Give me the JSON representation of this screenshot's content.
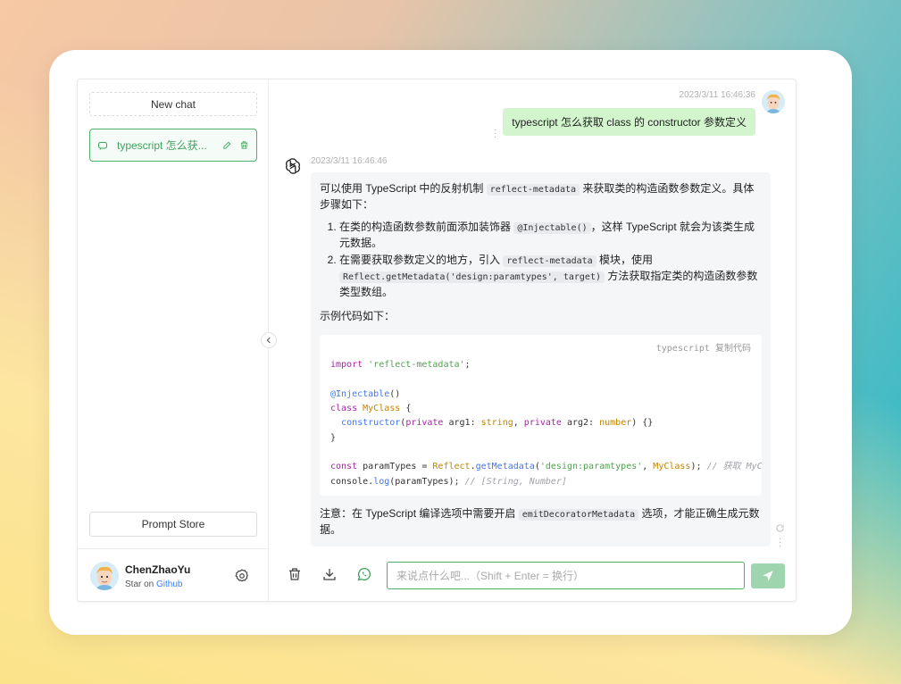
{
  "sidebar": {
    "new_chat_label": "New chat",
    "history": [
      {
        "title": "typescript 怎么获..."
      }
    ],
    "prompt_store_label": "Prompt Store",
    "user": {
      "name": "ChenZhaoYu",
      "sub_prefix": "Star on ",
      "sub_link": "Github"
    }
  },
  "messages": {
    "user": {
      "time": "2023/3/11 16:46:36",
      "text": "typescript 怎么获取 class 的 constructor 参数定义"
    },
    "bot": {
      "time": "2023/3/11 16:46:46",
      "intro_a": "可以使用 TypeScript 中的反射机制 ",
      "intro_code": "reflect-metadata",
      "intro_b": " 来获取类的构造函数参数定义。具体步骤如下：",
      "step1_a": "在类的构造函数参数前面添加装饰器 ",
      "step1_code": "@Injectable()",
      "step1_b": "，这样 TypeScript 就会为该类生成元数据。",
      "step2_a": "在需要获取参数定义的地方，引入 ",
      "step2_code1": "reflect-metadata",
      "step2_b": " 模块，使用 ",
      "step2_code2": "Reflect.getMetadata('design:paramtypes', target)",
      "step2_c": " 方法获取指定类的构造函数参数类型数组。",
      "example_label": "示例代码如下：",
      "code_lang": "typescript",
      "code_copy": "复制代码",
      "note_a": "注意：在 TypeScript 编译选项中需要开启 ",
      "note_code": "emitDecoratorMetadata",
      "note_b": " 选项，才能正确生成元数据。"
    }
  },
  "code": {
    "l1_kw": "import",
    "l1_str": "'reflect-metadata'",
    "l1_end": ";",
    "l3": "@Injectable",
    "l3_end": "()",
    "l4_kw": "class",
    "l4_cls": "MyClass",
    "l4_end": " {",
    "l5_fn": "constructor",
    "l5_p1": "(",
    "l5_kw1": "private",
    "l5_a1": " arg1: ",
    "l5_t1": "string",
    "l5_c": ", ",
    "l5_kw2": "private",
    "l5_a2": " arg2: ",
    "l5_t2": "number",
    "l5_end": ") {}",
    "l6": "}",
    "l8_kw": "const",
    "l8_a": " paramTypes = ",
    "l8_cls": "Reflect",
    "l8_dot": ".",
    "l8_fn": "getMetadata",
    "l8_p": "(",
    "l8_str": "'design:paramtypes'",
    "l8_c": ", ",
    "l8_cls2": "MyClass",
    "l8_end": "); ",
    "l8_cmt": "// 获取 MyClass 构造函数参数类型数组",
    "l9_a": "console",
    "l9_dot": ".",
    "l9_fn": "log",
    "l9_b": "(paramTypes); ",
    "l9_cmt": "// [String, Number]"
  },
  "footer": {
    "input_placeholder": "来说点什么吧...（Shift + Enter = 换行）",
    "input_value": ""
  },
  "colors": {
    "accent": "#4caf6a",
    "user_bubble": "#d2f5cd",
    "send_button": "#9ed4ae"
  }
}
